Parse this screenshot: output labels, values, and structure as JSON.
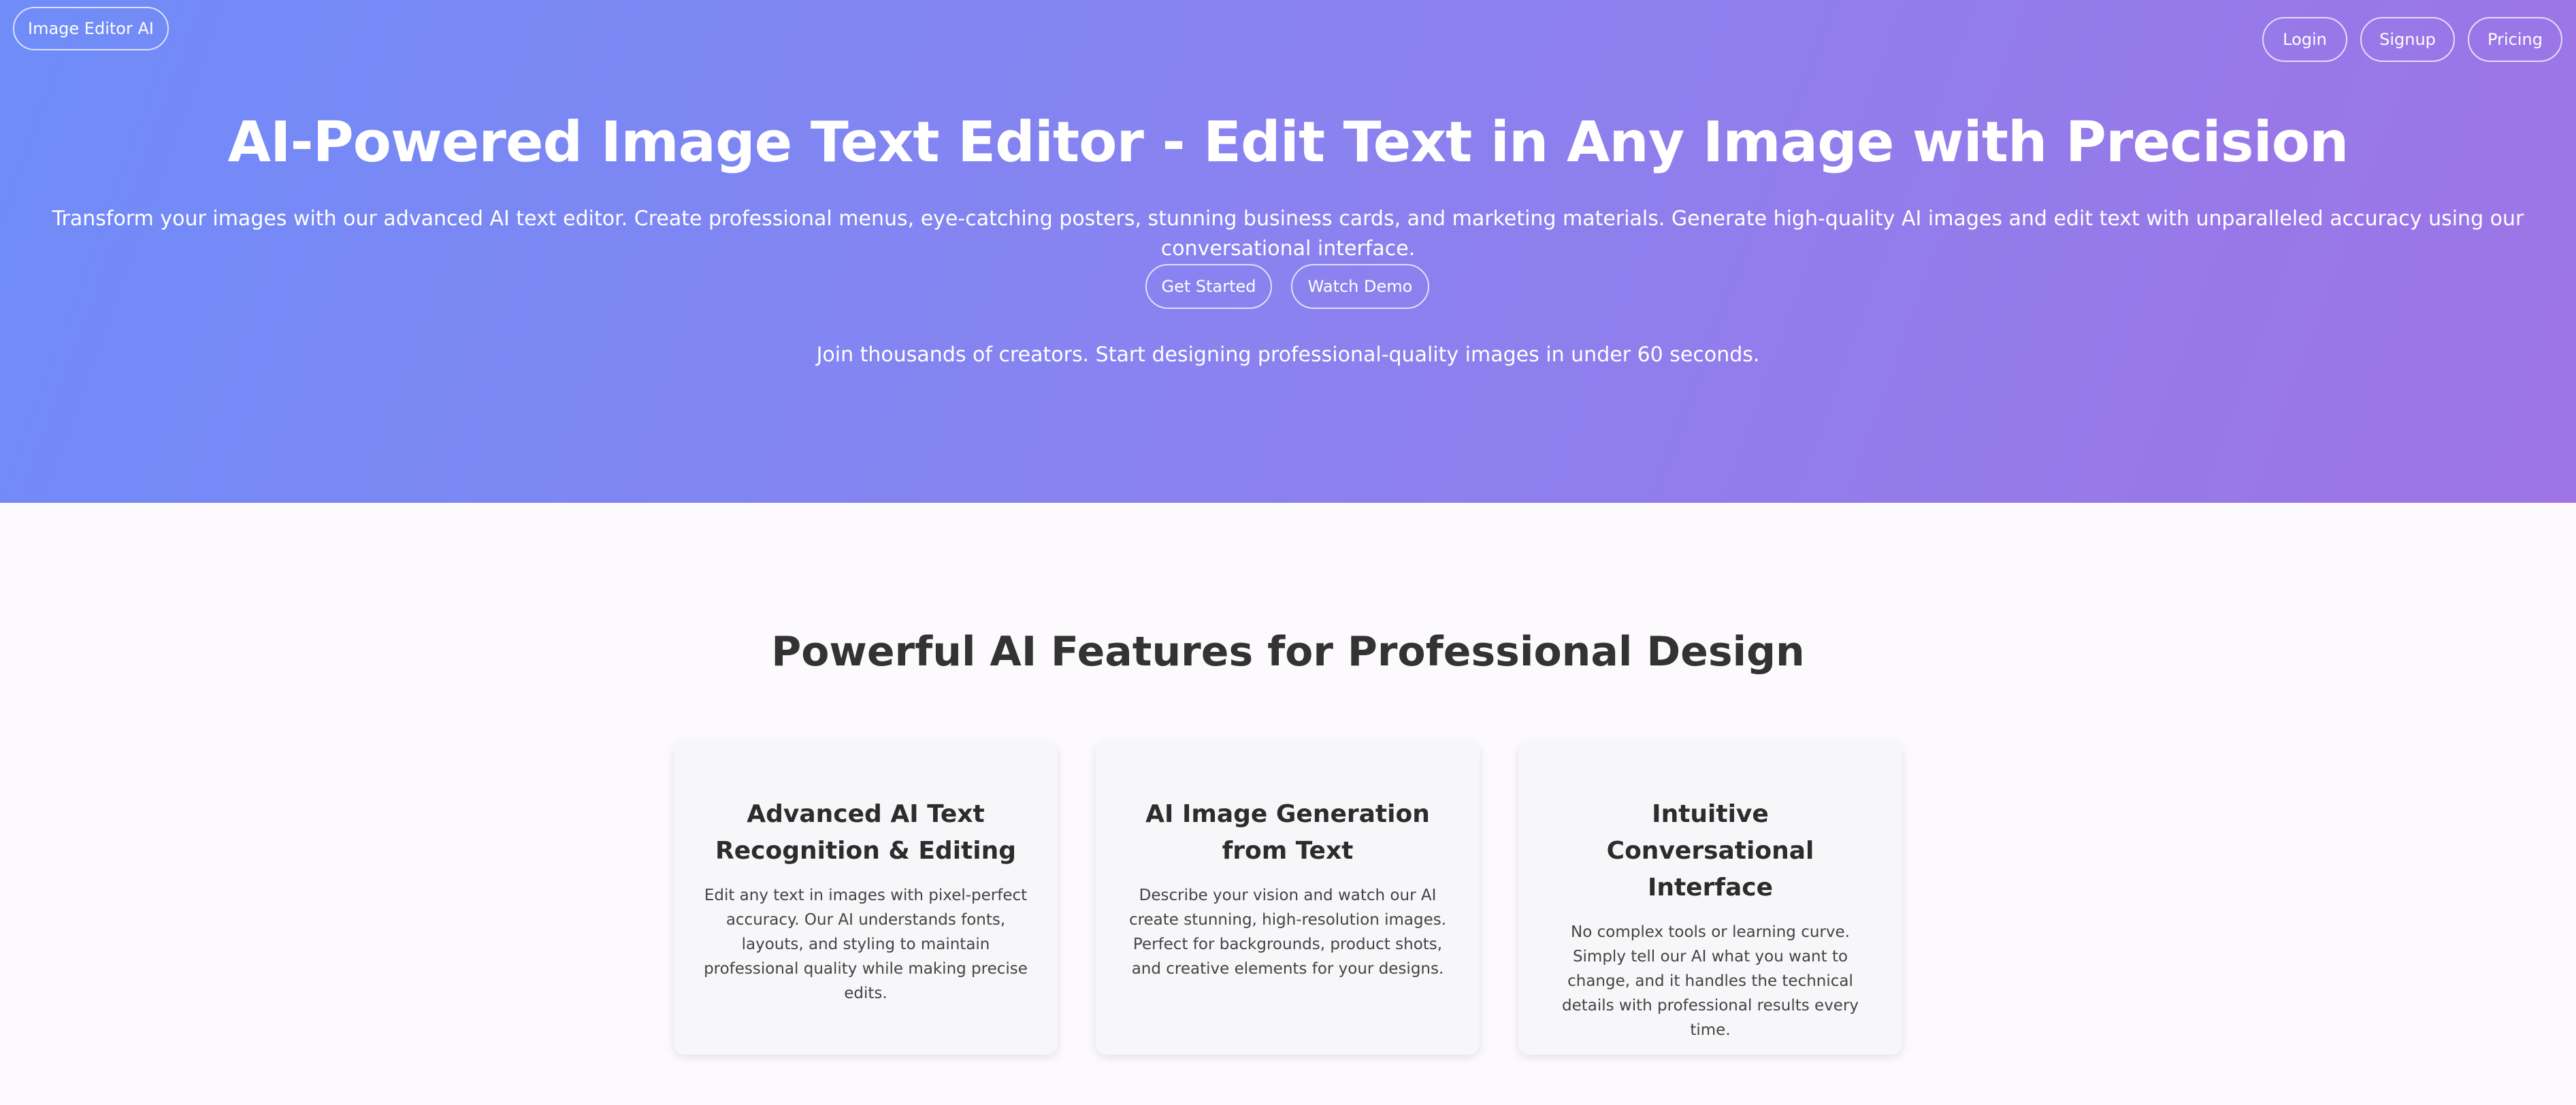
{
  "header": {
    "logo_label": "Image Editor AI",
    "nav": {
      "login": "Login",
      "signup": "Signup",
      "pricing": "Pricing"
    }
  },
  "hero": {
    "title": "AI-Powered Image Text Editor - Edit Text in Any Image with Precision",
    "subtitle": "Transform your images with our advanced AI text editor. Create professional menus, eye-catching posters, stunning business cards, and marketing materials. Generate high-quality AI images and edit text with unparalleled accuracy using our conversational interface.",
    "primary_cta": "Get Started",
    "secondary_cta": "Watch Demo",
    "note": "Join thousands of creators. Start designing professional-quality images in under 60 seconds."
  },
  "features": {
    "title": "Powerful AI Features for Professional Design",
    "cards": [
      {
        "title": "Advanced AI Text Recognition & Editing",
        "text": "Edit any text in images with pixel-perfect accuracy. Our AI understands fonts, layouts, and styling to maintain professional quality while making precise edits."
      },
      {
        "title": "AI Image Generation from Text",
        "text": "Describe your vision and watch our AI create stunning, high-resolution images. Perfect for backgrounds, product shots, and creative elements for your designs."
      },
      {
        "title": "Intuitive Conversational Interface",
        "text": "No complex tools or learning curve. Simply tell our AI what you want to change, and it handles the technical details with professional results every time."
      }
    ]
  },
  "colors": {
    "gradient_start": "#6f8cf8",
    "gradient_end": "#9e74e6",
    "heading_text": "#333333",
    "card_background": "#f7f6f8"
  }
}
